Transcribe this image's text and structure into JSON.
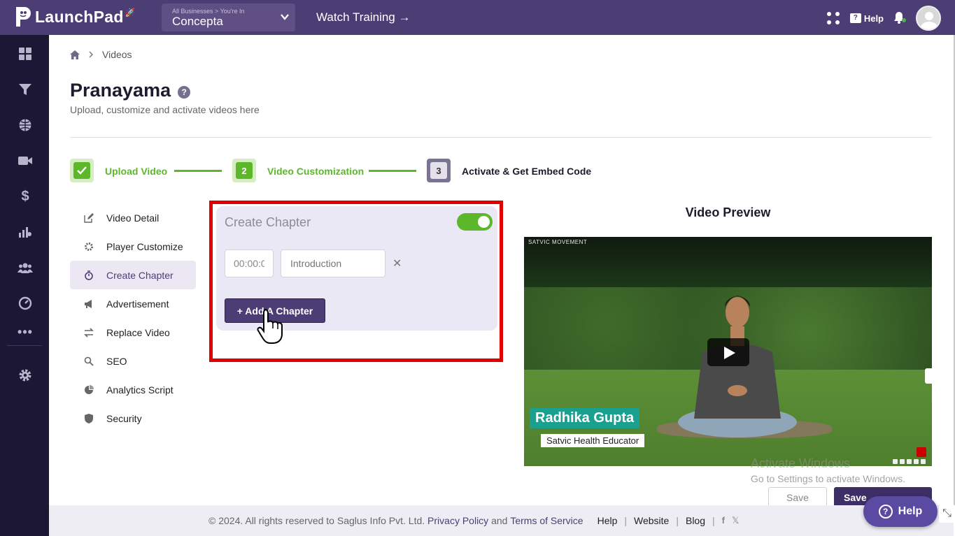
{
  "header": {
    "brand": "LaunchPad",
    "business_switch": {
      "caption": "All Businesses > You're In",
      "name": "Concepta"
    },
    "watch_training": "Watch Training →",
    "help_label": "Help"
  },
  "sidebar": {
    "icons": [
      "dashboard-icon",
      "funnel-icon",
      "globe-icon",
      "video-icon",
      "dollar-icon",
      "analytics-icon",
      "users-icon",
      "gauge-icon",
      "more-icon",
      "settings-icon"
    ]
  },
  "breadcrumb": {
    "current": "Videos"
  },
  "page": {
    "title": "Pranayama",
    "subtitle": "Upload, customize and activate videos here"
  },
  "steps": [
    {
      "num": "",
      "label": "Upload Video",
      "state": "done"
    },
    {
      "num": "2",
      "label": "Video Customization",
      "state": "done"
    },
    {
      "num": "3",
      "label": "Activate & Get Embed Code",
      "state": "current"
    }
  ],
  "menu": [
    {
      "label": "Video Detail",
      "icon": "edit-icon"
    },
    {
      "label": "Player Customize",
      "icon": "gear-icon"
    },
    {
      "label": "Create Chapter",
      "icon": "timer-icon",
      "active": true
    },
    {
      "label": "Advertisement",
      "icon": "megaphone-icon"
    },
    {
      "label": "Replace Video",
      "icon": "swap-icon"
    },
    {
      "label": "SEO",
      "icon": "search-icon"
    },
    {
      "label": "Analytics Script",
      "icon": "pie-icon"
    },
    {
      "label": "Security",
      "icon": "shield-icon"
    }
  ],
  "chapter": {
    "title": "Create Chapter",
    "toggle_on": true,
    "time_value": "00:00:0",
    "name_placeholder": "Introduction",
    "add_button": "+ Add A Chapter"
  },
  "preview": {
    "title": "Video Preview",
    "overlay_brand": "SATVIC MOVEMENT",
    "lower_third_name": "Radhika Gupta",
    "lower_third_role": "Satvic Health Educator"
  },
  "watermark": {
    "line1": "Activate Windows",
    "line2": "Go to Settings to activate Windows."
  },
  "actions": {
    "save_outline": "Save",
    "save_solid": "Save"
  },
  "footer": {
    "copyright": "©  2024. All rights reserved to Saglus Info Pvt. Ltd.",
    "privacy": "Privacy Policy",
    "and": "and",
    "terms": "Terms of Service",
    "help": "Help",
    "website": "Website",
    "blog": "Blog",
    "sep": "|"
  },
  "help_fab": "Help",
  "colors": {
    "topbar": "#4d3d75",
    "sidebar": "#1c1735",
    "accent_green": "#5cb82a",
    "highlight_frame": "#e00000"
  }
}
